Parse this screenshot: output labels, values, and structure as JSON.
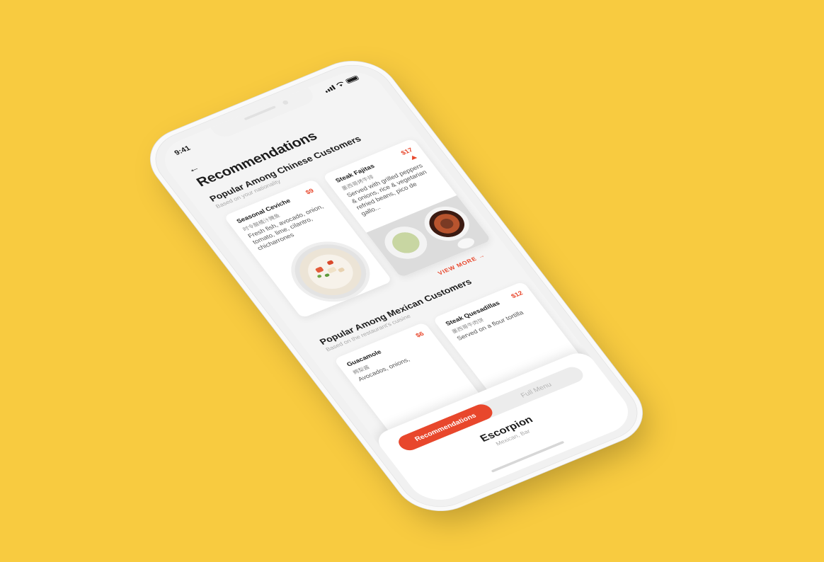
{
  "status": {
    "time": "9:41"
  },
  "header": {
    "title": "Recommendations"
  },
  "sections": [
    {
      "title": "Popular Among Chinese Customers",
      "subtitle": "Based on your nationality",
      "items": [
        {
          "name": "Seasonal Ceviche",
          "price": "$9",
          "name_cn": "时令酸橘汁腌鱼",
          "description": "Fresh fish, avocado, onion, tomato, lime, cilantro, chicharrones"
        },
        {
          "name": "Steak Fajitas",
          "price": "$17",
          "name_cn": "墨西哥烤牛排",
          "description": "Served with grilled peppers & onions, rice & vegetarian refried beans, pico de gallo..."
        }
      ],
      "view_more": "VIEW MORE"
    },
    {
      "title": "Popular Among Mexican Customers",
      "subtitle": "Based on the restaurant's cuisine",
      "items": [
        {
          "name": "Guacamole",
          "price": "$6",
          "name_cn": "鳄梨酱",
          "description": "Avocados, onions,"
        },
        {
          "name": "Steak Quesadillas",
          "price": "$12",
          "name_cn": "墨西哥牛肉饼",
          "description": "Served on a flour tortilla"
        }
      ]
    }
  ],
  "bottom_sheet": {
    "tabs": [
      "Recommendations",
      "Full Menu"
    ],
    "active_tab": "Recommendations",
    "restaurant_name": "Escorpion",
    "restaurant_type": "Mexican, Bar"
  },
  "colors": {
    "background": "#F8CB40",
    "accent": "#E8472C"
  },
  "icons": [
    "back-arrow-icon",
    "signal-icon",
    "wifi-icon",
    "battery-icon",
    "arrow-right-icon",
    "trending-up-icon"
  ]
}
